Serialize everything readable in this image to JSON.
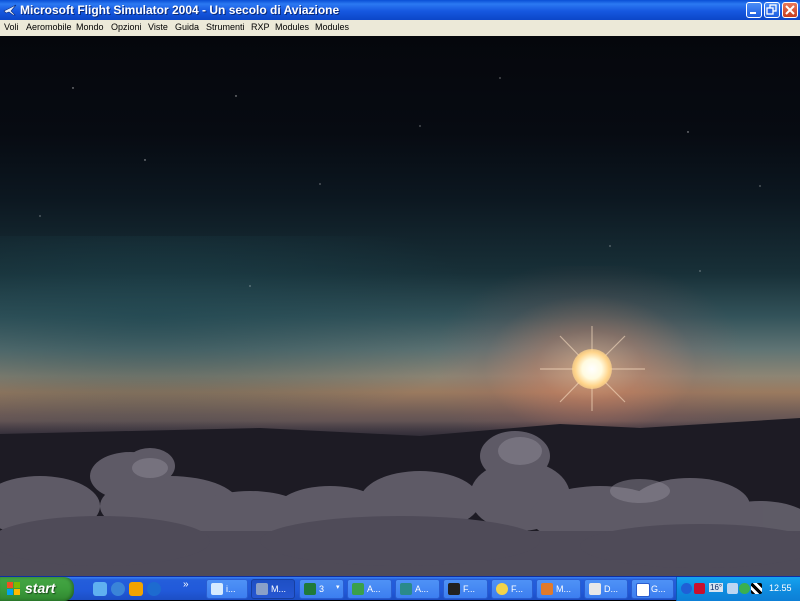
{
  "window": {
    "title": "Microsoft Flight Simulator 2004 - Un secolo di Aviazione",
    "app_icon": "plane-icon",
    "controls": [
      "minimize-icon",
      "maximize-icon",
      "close-icon"
    ]
  },
  "menu": {
    "items": [
      "Voli",
      "Aeromobile",
      "Mondo",
      "Opzioni",
      "Viste",
      "Guida",
      "Strumenti",
      "RXP",
      "Modules",
      "Modules"
    ]
  },
  "scene": {
    "description_icons": [
      "sun-icon",
      "clouds-icon"
    ]
  },
  "taskbar": {
    "start_label": "start",
    "quick_launch": [
      "messenger-icon",
      "ie-icon",
      "media-player-icon",
      "ie-alt-icon"
    ],
    "quick_launch_more": "»",
    "tasks": [
      {
        "label": "i...",
        "icon": "ie-icon"
      },
      {
        "label": "M...",
        "icon": "flight-sim-icon"
      },
      {
        "label": "3",
        "icon": "excel-icon"
      },
      {
        "label": "A...",
        "icon": "plane-icon"
      },
      {
        "label": "A...",
        "icon": "app-icon"
      },
      {
        "label": "F...",
        "icon": "console-icon"
      },
      {
        "label": "F...",
        "icon": "folder-icon"
      },
      {
        "label": "M...",
        "icon": "mail-icon"
      },
      {
        "label": "D...",
        "icon": "document-icon"
      },
      {
        "label": "G...",
        "icon": "word-icon"
      }
    ],
    "tray": {
      "temperature": "16°",
      "clock": "12.55",
      "icons": [
        "back-arrow-icon",
        "ati-icon",
        "volume-icon",
        "network-icon",
        "user-icon",
        "checker-icon"
      ]
    }
  },
  "colors": {
    "titlebar": "#2b79f2",
    "taskbar": "#245edb",
    "start": "#3c9d3c",
    "tray": "#0f8de0"
  }
}
